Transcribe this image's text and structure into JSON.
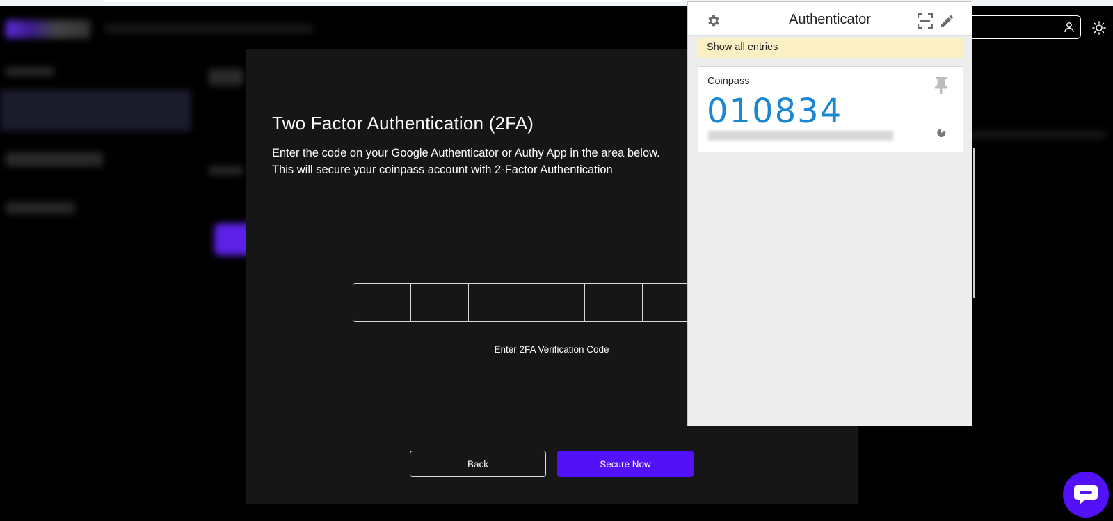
{
  "modal": {
    "title": "Two Factor Authentication (2FA)",
    "description_line1": "Enter the code on your Google Authenticator or Authy App in the area below.",
    "description_line2": "This will secure your coinpass account with 2-Factor Authentication",
    "code_hint": "Enter 2FA Verification Code",
    "back_label": "Back",
    "secure_label": "Secure Now"
  },
  "authenticator": {
    "title": "Authenticator",
    "show_all_label": "Show all entries",
    "entry": {
      "issuer": "Coinpass",
      "code": "010834"
    }
  },
  "icons": {
    "settings": "gear-icon",
    "scan": "scan-qr-icon",
    "edit": "pencil-icon",
    "pin": "pin-icon",
    "timer": "timer-pie-icon",
    "user": "user-icon",
    "theme": "sun-icon",
    "chat": "chat-bubble-icon"
  },
  "colors": {
    "accent": "#5211f7",
    "code_blue": "#1c87d1",
    "banner": "#fbf0c4",
    "modal_bg": "#161616"
  }
}
